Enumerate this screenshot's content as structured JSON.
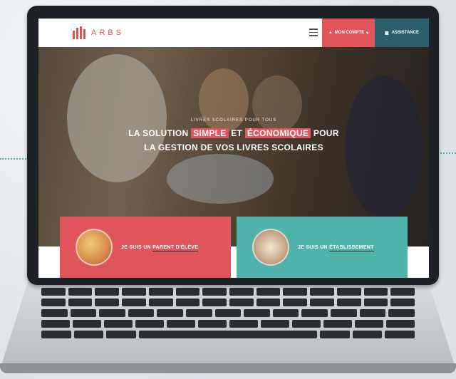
{
  "header": {
    "logo_text": "ARBS",
    "account_label": "MON COMPTE",
    "assist_label": "ASSISTANCE"
  },
  "hero": {
    "subtitle": "LIVRES SCOLAIRES POUR TOUS",
    "line1_a": "LA SOLUTION",
    "line1_hl1": "SIMPLE",
    "line1_b": "ET",
    "line1_hl2": "ÉCONOMIQUE",
    "line1_c": "POUR",
    "line2": "LA GESTION DE VOS LIVRES SCOLAIRES"
  },
  "cards": {
    "parent_prefix": "JE SUIS UN",
    "parent_emph": "PARENT D'ÉLÈVE",
    "school_prefix": "JE SUIS UN",
    "school_emph": "ÉTABLISSEMENT"
  },
  "colors": {
    "brand_red": "#e0545c",
    "brand_teal": "#4fb3ab",
    "assist_bg": "#2b5f6b"
  },
  "icons": [
    "menu-icon",
    "user-icon",
    "chat-icon",
    "chevron-down-icon"
  ]
}
